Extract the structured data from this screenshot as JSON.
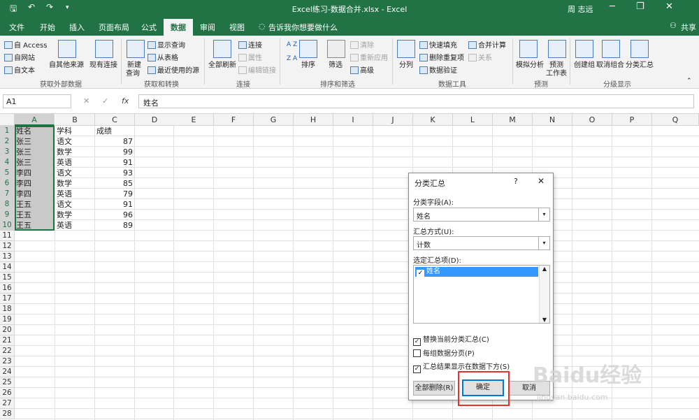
{
  "window": {
    "title": "Excel练习-数据合并.xlsx  -  Excel",
    "user": "周 志远"
  },
  "tabs": [
    "文件",
    "开始",
    "插入",
    "页面布局",
    "公式",
    "数据",
    "审阅",
    "视图"
  ],
  "tell_me": "告诉我你想要做什么",
  "share": "共享",
  "ribbon": {
    "ext": {
      "items": [
        "自 Access",
        "自网站",
        "自文本"
      ],
      "other": "自其他来源",
      "existing": "现有连接",
      "label": "获取外部数据"
    },
    "transform": {
      "new_query": "新建",
      "new_query2": "查询",
      "items": [
        "显示查询",
        "从表格",
        "最近使用的源"
      ],
      "label": "获取和转换"
    },
    "conn": {
      "refresh": "全部刷新",
      "items": [
        "连接",
        "属性",
        "编辑链接"
      ],
      "label": "连接"
    },
    "sort": {
      "sort": "排序",
      "filter": "筛选",
      "items": [
        "清除",
        "重新应用",
        "高级"
      ],
      "label": "排序和筛选",
      "az_top": "A Z",
      "az_bot": "Z A"
    },
    "tools": {
      "split": "分列",
      "items": [
        "快速填充",
        "删除重复项",
        "数据验证"
      ],
      "merge": "合并计算",
      "relation": "关系",
      "label": "数据工具"
    },
    "forecast": {
      "whatif": "模拟分析",
      "sheet": "预测",
      "sheet2": "工作表",
      "label": "预测"
    },
    "outline": {
      "group": "创建组",
      "ungroup": "取消组合",
      "subtotal": "分类汇总",
      "label": "分级显示"
    }
  },
  "formula_bar": {
    "name_box": "A1",
    "cancel": "✕",
    "enter": "✓",
    "fx": "fx",
    "value": "姓名"
  },
  "columns": [
    "A",
    "B",
    "C",
    "D",
    "E",
    "F",
    "G",
    "H",
    "I",
    "J",
    "K",
    "L",
    "M",
    "N",
    "O",
    "P",
    "Q"
  ],
  "rows": [
    "1",
    "2",
    "3",
    "4",
    "5",
    "6",
    "7",
    "8",
    "9",
    "10",
    "11",
    "12",
    "13",
    "14",
    "15",
    "16",
    "17",
    "18",
    "19",
    "20",
    "21",
    "22",
    "23",
    "24",
    "25",
    "26",
    "27",
    "28"
  ],
  "cells": [
    [
      "姓名",
      "学科",
      "成绩"
    ],
    [
      "张三",
      "语文",
      "87"
    ],
    [
      "张三",
      "数学",
      "99"
    ],
    [
      "张三",
      "英语",
      "91"
    ],
    [
      "李四",
      "语文",
      "93"
    ],
    [
      "李四",
      "数学",
      "85"
    ],
    [
      "李四",
      "英语",
      "79"
    ],
    [
      "王五",
      "语文",
      "91"
    ],
    [
      "王五",
      "数学",
      "96"
    ],
    [
      "王五",
      "英语",
      "89"
    ]
  ],
  "dialog": {
    "title": "分类汇总",
    "help": "?",
    "close": "✕",
    "field_label": "分类字段(A):",
    "field_value": "姓名",
    "func_label": "汇总方式(U):",
    "func_value": "计数",
    "items_label": "选定汇总项(D):",
    "list": [
      {
        "label": "姓名",
        "checked": true
      }
    ],
    "options": [
      {
        "label": "替换当前分类汇总(C)",
        "checked": true
      },
      {
        "label": "每组数据分页(P)",
        "checked": false
      },
      {
        "label": "汇总结果显示在数据下方(S)",
        "checked": true
      }
    ],
    "remove_all": "全部删除(R)",
    "ok": "确定",
    "cancel": "取消"
  },
  "watermark": {
    "brand": "Baidu经验",
    "url": "jingyan.baidu.com"
  },
  "colors": {
    "excel_green": "#217346",
    "highlight": "#e5322d",
    "focus": "#0078d7"
  }
}
